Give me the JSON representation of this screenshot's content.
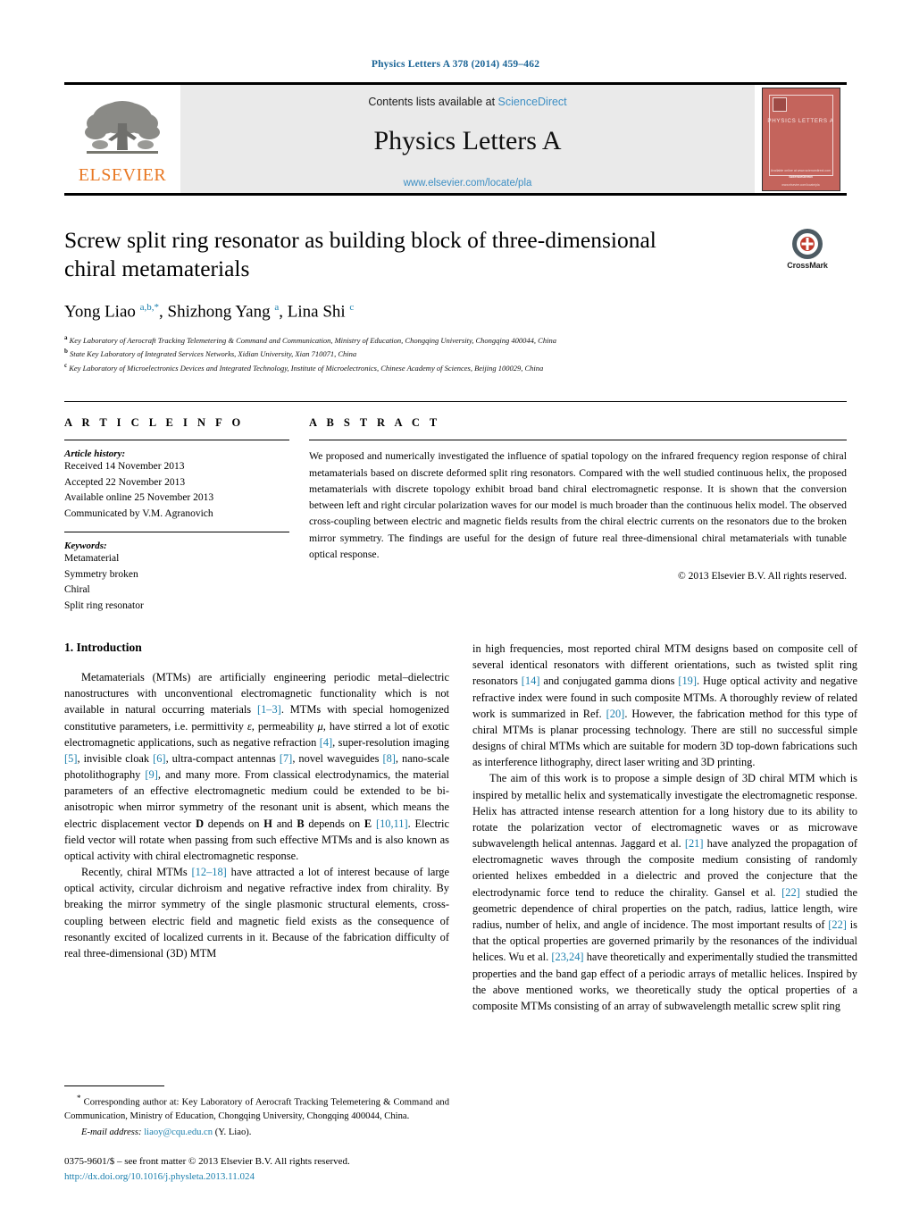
{
  "running_head": "Physics Letters A 378 (2014) 459–462",
  "masthead": {
    "publisher_name": "ELSEVIER",
    "contents_prefix": "Contents lists available at",
    "contents_link": "ScienceDirect",
    "journal_title": "Physics Letters A",
    "journal_url": "www.elsevier.com/locate/pla",
    "cover": {
      "title": "PHYSICS LETTERS A",
      "footer_small": "Available online at www.sciencedirect.com",
      "footer_brand": "ScienceDirect",
      "bottom_bar": "www.elsevier.com/locate/pla"
    }
  },
  "article": {
    "title": "Screw split ring resonator as building block of three-dimensional chiral metamaterials",
    "crossmark_label": "CrossMark",
    "authors_html": "Yong Liao <sup>a,b,</sup><sup>*</sup>, Shizhong Yang <sup>a</sup>, Lina Shi <sup>c</sup>",
    "affiliations": [
      {
        "mark": "a",
        "text": "Key Laboratory of Aerocraft Tracking Telemetering & Command and Communication, Ministry of Education, Chongqing University, Chongqing 400044, China"
      },
      {
        "mark": "b",
        "text": "State Key Laboratory of Integrated Services Networks, Xidian University, Xian 710071, China"
      },
      {
        "mark": "c",
        "text": "Key Laboratory of Microelectronics Devices and Integrated Technology, Institute of Microelectronics, Chinese Academy of Sciences, Beijing 100029, China"
      }
    ]
  },
  "article_info": {
    "heading": "A R T I C L E    I N F O",
    "history_label": "Article history:",
    "history": [
      "Received 14 November 2013",
      "Accepted 22 November 2013",
      "Available online 25 November 2013",
      "Communicated by V.M. Agranovich"
    ],
    "keywords_label": "Keywords:",
    "keywords": [
      "Metamaterial",
      "Symmetry broken",
      "Chiral",
      "Split ring resonator"
    ]
  },
  "abstract": {
    "heading": "A B S T R A C T",
    "text": "We proposed and numerically investigated the influence of spatial topology on the infrared frequency region response of chiral metamaterials based on discrete deformed split ring resonators. Compared with the well studied continuous helix, the proposed metamaterials with discrete topology exhibit broad band chiral electromagnetic response. It is shown that the conversion between left and right circular polarization waves for our model is much broader than the continuous helix model. The observed cross-coupling between electric and magnetic fields results from the chiral electric currents on the resonators due to the broken mirror symmetry. The findings are useful for the design of future real three-dimensional chiral metamaterials with tunable optical response.",
    "copyright": "© 2013 Elsevier B.V. All rights reserved."
  },
  "body": {
    "section_number_title": "1. Introduction",
    "left_paragraphs": [
      "Metamaterials (MTMs) are artificially engineering periodic metal–dielectric nanostructures with unconventional electromagnetic functionality which is not available in natural occurring materials [1–3]. MTMs with special homogenized constitutive parameters, i.e. permittivity ε, permeability μ, have stirred a lot of exotic electromagnetic applications, such as negative refraction [4], super-resolution imaging [5], invisible cloak [6], ultra-compact antennas [7], novel waveguides [8], nano-scale photolithography [9], and many more. From classical electrodynamics, the material parameters of an effective electromagnetic medium could be extended to be bi-anisotropic when mirror symmetry of the resonant unit is absent, which means the electric displacement vector D depends on H and B depends on E [10,11]. Electric field vector will rotate when passing from such effective MTMs and is also known as optical activity with chiral electromagnetic response.",
      "Recently, chiral MTMs [12–18] have attracted a lot of interest because of large optical activity, circular dichroism and negative refractive index from chirality. By breaking the mirror symmetry of the single plasmonic structural elements, cross-coupling between electric field and magnetic field exists as the consequence of resonantly excited of localized currents in it. Because of the fabrication difficulty of real three-dimensional (3D) MTM"
    ],
    "right_paragraphs": [
      "in high frequencies, most reported chiral MTM designs based on composite cell of several identical resonators with different orientations, such as twisted split ring resonators [14] and conjugated gamma dions [19]. Huge optical activity and negative refractive index were found in such composite MTMs. A thoroughly review of related work is summarized in Ref. [20]. However, the fabrication method for this type of chiral MTMs is planar processing technology. There are still no successful simple designs of chiral MTMs which are suitable for modern 3D top-down fabrications such as interference lithography, direct laser writing and 3D printing.",
      "The aim of this work is to propose a simple design of 3D chiral MTM which is inspired by metallic helix and systematically investigate the electromagnetic response. Helix has attracted intense research attention for a long history due to its ability to rotate the polarization vector of electromagnetic waves or as microwave subwavelength helical antennas. Jaggard et al. [21] have analyzed the propagation of electromagnetic waves through the composite medium consisting of randomly oriented helixes embedded in a dielectric and proved the conjecture that the electrodynamic force tend to reduce the chirality. Gansel et al. [22] studied the geometric dependence of chiral properties on the patch, radius, lattice length, wire radius, number of helix, and angle of incidence. The most important results of [22] is that the optical properties are governed primarily by the resonances of the individual helices. Wu et al. [23,24] have theoretically and experimentally studied the transmitted properties and the band gap effect of a periodic arrays of metallic helices. Inspired by the above mentioned works, we theoretically study the optical properties of a composite MTMs consisting of an array of subwavelength metallic screw split ring"
    ]
  },
  "footnotes": {
    "corresponding_mark": "*",
    "corresponding_text": "Corresponding author at: Key Laboratory of Aerocraft Tracking Telemetering & Command and Communication, Ministry of Education, Chongqing University, Chongqing 400044, China.",
    "email_label": "E-mail address:",
    "email_address": "liaoy@cqu.edu.cn",
    "email_owner": "(Y. Liao).",
    "issn_line": "0375-9601/$ – see front matter  © 2013 Elsevier B.V. All rights reserved.",
    "doi_line": "http://dx.doi.org/10.1016/j.physleta.2013.11.024"
  },
  "colors": {
    "link_blue": "#1a7fad",
    "header_blue": "#1a6496",
    "elsevier_orange": "#E87722",
    "cover_red": "#c4645c",
    "masthead_gray": "#eaeaea"
  }
}
